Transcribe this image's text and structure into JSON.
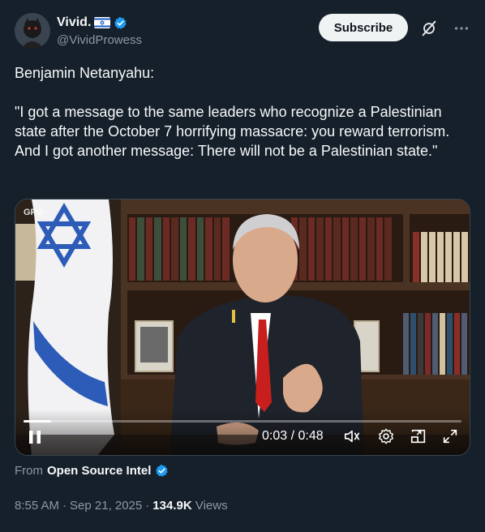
{
  "author": {
    "display_name": "Vivid.",
    "handle": "@VividProwess",
    "flag_icon": "israel-flag-icon",
    "verified_icon": "verified-badge-icon"
  },
  "header": {
    "subscribe_label": "Subscribe",
    "grok_icon": "grok-icon",
    "more_icon": "more-icon"
  },
  "tweet": {
    "text": "Benjamin Netanyahu:\n\n\"I got a message to the same leaders who recognize a Palestinian state after the October 7 horrifying massacre: you reward terrorism. And I got another message: There will not be a Palestinian state.\""
  },
  "video": {
    "watermark": "GPO",
    "current_time": "0:03",
    "separator": "/",
    "duration": "0:48",
    "progress_fraction": 0.0625,
    "icons": [
      "pause-icon",
      "volume-icon",
      "settings-icon",
      "pip-icon",
      "fullscreen-icon"
    ]
  },
  "source": {
    "prefix": "From",
    "name": "Open Source Intel"
  },
  "meta": {
    "time": "8:55 AM",
    "dot1": "·",
    "date": "Sep 21, 2025",
    "dot2": "·",
    "views_count": "134.9K",
    "views_label": "Views"
  },
  "colors": {
    "background": "#15202b",
    "verified": "#1d9bf0",
    "muted": "#8b98a5"
  }
}
